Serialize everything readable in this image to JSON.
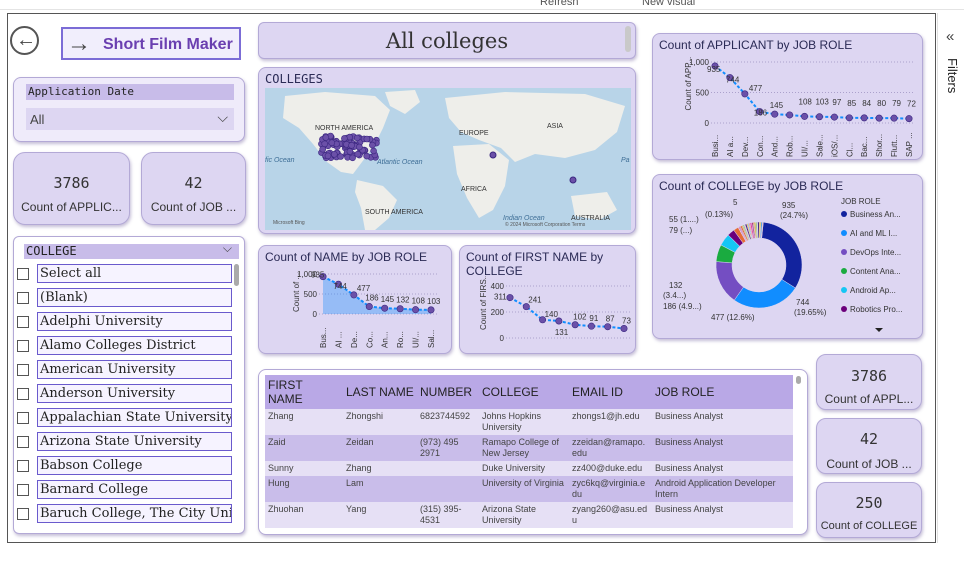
{
  "ribbon": {
    "refresh": "Refresh",
    "new_visual": "New visual"
  },
  "nav": {
    "back_label": "←",
    "link_label": "Short Film Maker"
  },
  "page_title": "All colleges",
  "date_slicer": {
    "title": "Application Date",
    "value": "All"
  },
  "kpi_left": [
    {
      "value": "3786",
      "label": "Count of APPLIC..."
    },
    {
      "value": "42",
      "label": "Count of JOB ..."
    }
  ],
  "kpi_right": [
    {
      "value": "3786",
      "label": "Count of APPL..."
    },
    {
      "value": "42",
      "label": "Count of JOB ..."
    },
    {
      "value": "250",
      "label": "Count of COLLEGE"
    }
  ],
  "college_slicer": {
    "title": "COLLEGE",
    "items": [
      "Select all",
      "(Blank)",
      "Adelphi University",
      "Alamo Colleges District",
      "American University",
      "Anderson University",
      "Appalachian State University",
      "Arizona State University",
      "Babson College",
      "Barnard College",
      "Baruch College, The City Unive..."
    ]
  },
  "map": {
    "title": "COLLEGES",
    "labels": {
      "na": "NORTH AMERICA",
      "eu": "EUROPE",
      "as": "ASIA",
      "af": "AFRICA",
      "sa": "SOUTH AMERICA",
      "au": "AUSTRALIA",
      "pac": "fic Ocean",
      "atl": "Atlantic Ocean",
      "ind": "Indian Ocean",
      "pa": "Pa"
    },
    "bing": "Microsoft Bing",
    "copyright": "© 2024 Microsoft Corporation  Terms"
  },
  "filters": {
    "label": "Filters",
    "collapse": "«"
  },
  "table": {
    "headers": [
      "FIRST NAME",
      "LAST NAME",
      "NUMBER",
      "COLLEGE",
      "EMAIL ID",
      "JOB ROLE"
    ],
    "rows": [
      [
        "Zhang",
        "Zhongshi",
        "6823744592",
        "Johns Hopkins University",
        "zhongs1@jh.edu",
        "Business Analyst"
      ],
      [
        "Zaid",
        "Zeidan",
        "(973) 495 2971",
        "Ramapo College of New Jersey",
        "zzeidan@ramapo.edu",
        "Business Analyst"
      ],
      [
        "Sunny",
        "Zhang",
        "",
        "Duke University",
        "zz400@duke.edu",
        "Business Analyst"
      ],
      [
        "Hung",
        "Lam",
        "",
        "University of Virginia",
        "zyc6kq@virginia.edu",
        "Android Application Developer Intern"
      ],
      [
        "Zhuohan",
        "Yang",
        "(315) 395-4531",
        "Arizona State University",
        "zyang260@asu.edu",
        "Business Analyst"
      ]
    ]
  },
  "chart_data": [
    {
      "type": "line",
      "title": "Count of APPLICANT by JOB ROLE",
      "ylabel": "Count of APP...",
      "ylim": [
        0,
        1000
      ],
      "yticks": [
        "1,000",
        "500",
        "0"
      ],
      "categories": [
        "Busi...",
        "AI a...",
        "Dev...",
        "Con...",
        "And...",
        "Rob...",
        "UI/...",
        "Sale...",
        "iOS/...",
        "Cl...",
        "Bac...",
        "Shor...",
        "Flutt...",
        "SAP ..."
      ],
      "values": [
        935,
        744,
        477,
        186,
        145,
        132,
        108,
        103,
        97,
        85,
        84,
        80,
        79,
        72
      ],
      "data_labels": [
        "935",
        "744",
        "477",
        "186",
        "145",
        "108",
        "103",
        "97",
        "85",
        "84",
        "80",
        "79",
        "72"
      ]
    },
    {
      "type": "pie",
      "title": "Count of COLLEGE by JOB ROLE",
      "legend_title": "JOB ROLE",
      "legend": [
        "Business An...",
        "AI and ML I...",
        "DevOps Inte...",
        "Content Ana...",
        "Android Ap...",
        "Robotics Pro..."
      ],
      "slices": [
        935,
        744,
        477,
        186,
        132,
        79,
        55,
        5
      ],
      "colors": [
        "#12239e",
        "#118dff",
        "#744ec2",
        "#1aab40",
        "#15c6f4",
        "#6b007b",
        "#e66c37",
        "#d9b300"
      ],
      "labels": [
        "935 (24.7%)",
        "744 (19.65%)",
        "477 (12.6%)",
        "186 (4.9...)",
        "132 (3.4...)",
        "79 (...)",
        "55 (1....)",
        "(0.13%)",
        "5"
      ]
    },
    {
      "type": "line",
      "title": "Count of NAME by JOB ROLE",
      "ylabel": "Count of ...",
      "ylim": [
        0,
        1000
      ],
      "yticks": [
        "1,000",
        "500",
        "0"
      ],
      "categories": [
        "Bus...",
        "AI ...",
        "De...",
        "Co...",
        "An...",
        "Ro...",
        "UI/...",
        "Sal..."
      ],
      "values": [
        935,
        744,
        477,
        186,
        145,
        132,
        108,
        103
      ],
      "data_labels": [
        "935",
        "744",
        "477",
        "186",
        "145",
        "132",
        "108",
        "103"
      ]
    },
    {
      "type": "line",
      "title": "Count of FIRST NAME by COLLEGE",
      "ylabel": "Count of FIRS...",
      "ylim": [
        0,
        400
      ],
      "yticks": [
        "400",
        "200",
        "0"
      ],
      "values": [
        311,
        241,
        140,
        131,
        102,
        91,
        87,
        73
      ],
      "data_labels": [
        "311",
        "241",
        "140",
        "131",
        "102",
        "91",
        "87",
        "73"
      ]
    }
  ]
}
